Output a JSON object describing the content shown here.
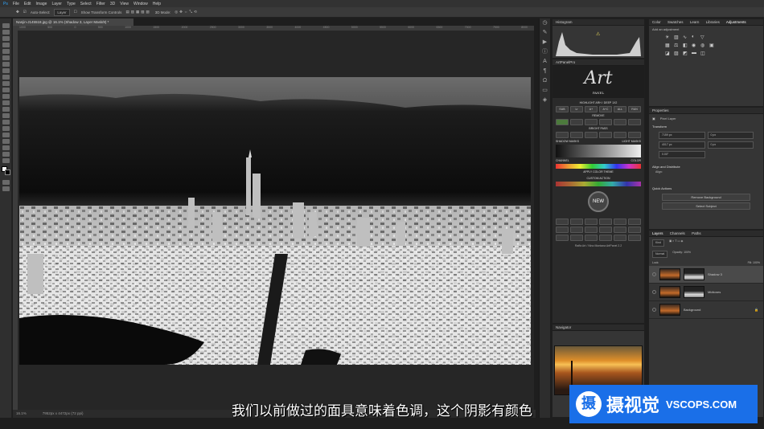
{
  "menu": [
    "File",
    "Edit",
    "Image",
    "Layer",
    "Type",
    "Select",
    "Filter",
    "3D",
    "View",
    "Window",
    "Help"
  ],
  "options": {
    "auto_select": "Auto-Select:",
    "layer": "Layer",
    "show_transform": "Show Transform Controls",
    "mode_3d": "3D Mode:"
  },
  "document": {
    "tab": "Nanjin-J145518.jpg @ 16.1% (Shadow 3, Layer Mask/8) *",
    "zoom": "16.1%",
    "doc_info": "7952px x 4472px (72 ppi)"
  },
  "ruler_ticks": [
    "1000",
    "500",
    "0",
    "500",
    "1000",
    "1500",
    "2000",
    "2500",
    "3000",
    "3500",
    "4000",
    "4500",
    "5000",
    "5500",
    "6000",
    "6500",
    "7000",
    "7500",
    "8000"
  ],
  "panels": {
    "histogram": "Histogram",
    "artpanel": "ArtPanelPro",
    "navigator": "Navigator",
    "adj_tabs": [
      "Color",
      "Swatches",
      "Learn",
      "Libraries",
      "Adjustments"
    ],
    "adj_add": "Add an adjustment",
    "properties": "Properties",
    "pixel_layer": "Pixel Layer",
    "transform": "Transform",
    "align": "Align and Distribute",
    "align_sub": "Align:",
    "quick": "Quick Actions",
    "remove_bg": "Remove Background",
    "select_subject": "Select Subject",
    "layer_tabs": [
      "Layers",
      "Channels",
      "Paths"
    ],
    "kind": "Kind",
    "normal": "Normal",
    "opacity": "Opacity: 100%",
    "lock": "Lock:",
    "fill": "Fill: 100%"
  },
  "transform_values": {
    "w": "7159 px",
    "h": "4017 px",
    "x": "0 px",
    "y": "0 px",
    "angle": "0.00°"
  },
  "art": {
    "logo": "Art",
    "logo_sub": "PANEL",
    "labels": [
      "HIGHLIGHT ARH / DEEP 1X2",
      "REMOVE",
      "BRIGHT PASS",
      "SIDE FREQ %",
      "COLOR LAB",
      "SHADOW MASKS",
      "LIGHT MASKS",
      "CHANNEL",
      "COLOR",
      "APPLY COLOR THEME",
      "CUSTOM ACTION"
    ],
    "buttons": [
      "SUB",
      "Lr",
      "A+",
      "A+C",
      "ALL",
      "RUN",
      "NEW"
    ],
    "footer": "Raffa Art / Nino Montana ArtPanel 2.2"
  },
  "layers": [
    {
      "name": "Shadow 3",
      "selected": true
    },
    {
      "name": "Midtones",
      "selected": false
    },
    {
      "name": "Background",
      "selected": false
    }
  ],
  "subtitle": "我们以前做过的面具意味着色调，这个阴影有颜色",
  "brand": {
    "logo": "摄",
    "name": "摄视觉",
    "url": "VSCOPS.COM"
  },
  "colors": {
    "accent": "#1a6fe8",
    "panel": "#353535",
    "canvas": "#262626"
  }
}
